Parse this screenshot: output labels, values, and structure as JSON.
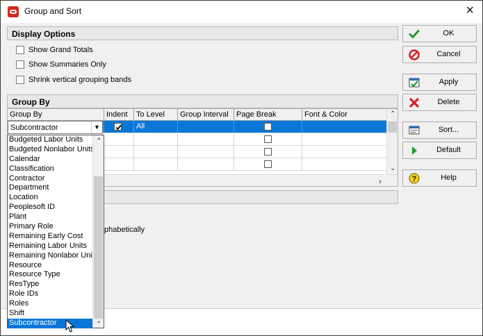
{
  "window": {
    "title": "Group and Sort",
    "close_glyph": "×"
  },
  "display_options": {
    "header": "Display Options",
    "checkboxes": [
      {
        "label": "Show Grand Totals",
        "checked": false
      },
      {
        "label": "Show Summaries Only",
        "checked": false
      },
      {
        "label": "Shrink vertical grouping bands",
        "checked": false
      }
    ]
  },
  "group_by": {
    "header": "Group By",
    "columns": [
      "Group By",
      "Indent",
      "To Level",
      "Group Interval",
      "Page Break",
      "Font & Color"
    ],
    "combo_value": "Subcontractor",
    "first_row": {
      "indent_checked": true,
      "to_level": "All",
      "page_break_checked": false
    }
  },
  "dropdown": {
    "items": [
      "Budgeted Labor Units",
      "Budgeted Nonlabor Units",
      "Calendar",
      "Classification",
      "Contractor",
      "Department",
      "Location",
      "Peoplesoft ID",
      "Plant",
      "Primary Role",
      "Remaining Early Cost",
      "Remaining Labor Units",
      "Remaining Nonlabor Units",
      "Resource",
      "Resource Type",
      "ResType",
      "Role IDs",
      "Roles",
      "Shift",
      "Subcontractor"
    ],
    "selected": "Subcontractor"
  },
  "lower": {
    "partial_text": "phabetically"
  },
  "buttons": {
    "ok": "OK",
    "cancel": "Cancel",
    "apply": "Apply",
    "delete": "Delete",
    "sort": "Sort...",
    "default": "Default",
    "help": "Help"
  },
  "icons": {
    "app": "oracle-logo-icon",
    "ok": "checkmark-icon",
    "cancel": "no-entry-icon",
    "apply": "apply-icon",
    "delete": "red-x-icon",
    "sort": "sort-dialog-icon",
    "default": "green-arrow-icon",
    "help": "question-icon"
  },
  "colors": {
    "selection": "#0a77d8",
    "ok_green": "#1f9a2e",
    "cancel_red": "#d32020",
    "help_yellow": "#f4d21a"
  }
}
